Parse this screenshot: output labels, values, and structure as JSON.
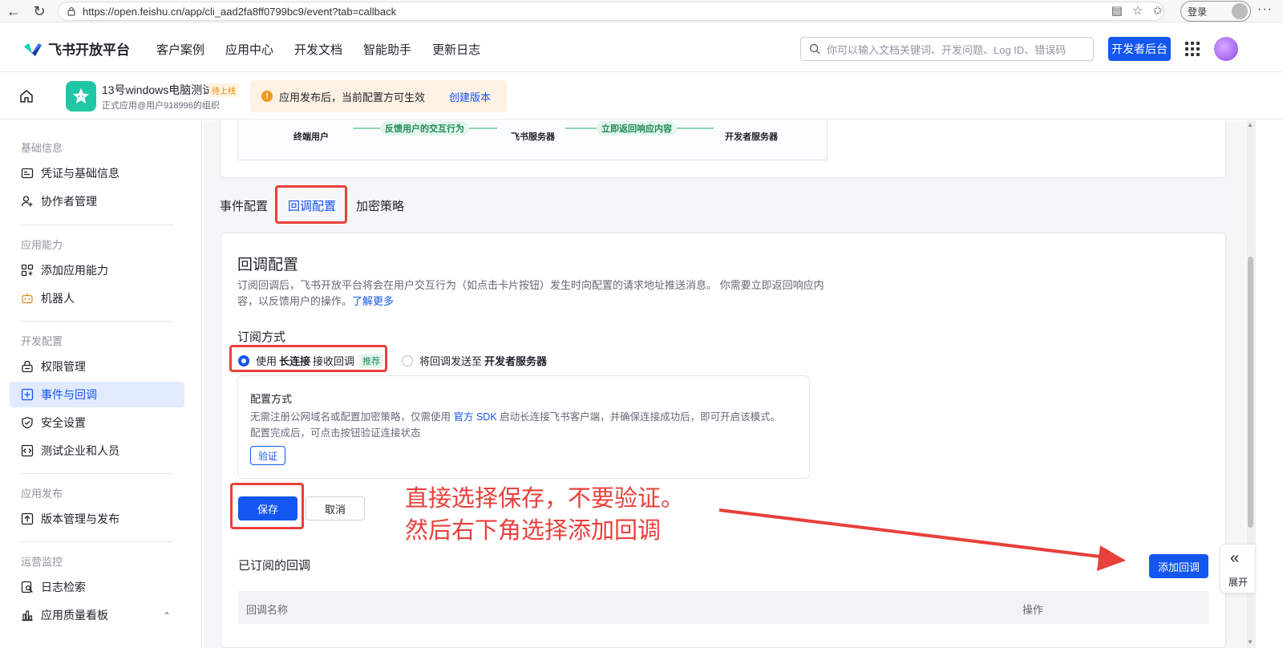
{
  "browser": {
    "url": "https://open.feishu.cn/app/cli_aad2fa8ff0799bc9/event?tab=callback",
    "login_label": "登录"
  },
  "topnav": {
    "logo_text": "飞书开放平台",
    "links": [
      "客户案例",
      "应用中心",
      "开发文档",
      "智能助手",
      "更新日志"
    ],
    "search_placeholder": "你可以输入文档关键词、开发问题、Log ID、错误码",
    "dev_button": "开发者后台"
  },
  "appbar": {
    "app_name": "13号windows电脑测试",
    "status_badge": "待上线",
    "app_sub": "正式应用@用户918996的组织",
    "notice_text": "应用发布后，当前配置方可生效",
    "notice_link": "创建版本"
  },
  "sidebar": {
    "sections": [
      {
        "title": "基础信息",
        "items": [
          {
            "label": "凭证与基础信息",
            "icon": "credential-icon"
          },
          {
            "label": "协作者管理",
            "icon": "user-add-icon"
          }
        ]
      },
      {
        "title": "应用能力",
        "items": [
          {
            "label": "添加应用能力",
            "icon": "grid-add-icon"
          },
          {
            "label": "机器人",
            "icon": "robot-icon"
          }
        ]
      },
      {
        "title": "开发配置",
        "items": [
          {
            "label": "权限管理",
            "icon": "lock-icon"
          },
          {
            "label": "事件与回调",
            "icon": "event-icon"
          },
          {
            "label": "安全设置",
            "icon": "shield-icon"
          },
          {
            "label": "测试企业和人员",
            "icon": "code-icon"
          }
        ]
      },
      {
        "title": "应用发布",
        "items": [
          {
            "label": "版本管理与发布",
            "icon": "upload-icon"
          }
        ]
      },
      {
        "title": "运营监控",
        "items": [
          {
            "label": "日志检索",
            "icon": "log-search-icon"
          },
          {
            "label": "应用质量看板",
            "icon": "bar-chart-icon"
          }
        ]
      }
    ],
    "active_item": "事件与回调"
  },
  "diagram": {
    "node_end_user": "终端用户",
    "node_feishu_server": "飞书服务器",
    "node_dev_server": "开发者服务器",
    "arrow_feedback": "反馈用户的交互行为",
    "arrow_return": "立即返回响应内容"
  },
  "tabs": [
    {
      "label": "事件配置",
      "active": false
    },
    {
      "label": "回调配置",
      "active": true
    },
    {
      "label": "加密策略",
      "active": false
    }
  ],
  "callback": {
    "title": "回调配置",
    "desc": "订阅回调后，飞书开放平台将会在用户交互行为（如点击卡片按钮）发生时向配置的请求地址推送消息。 你需要立即返回响应内容，以反馈用户的操作。",
    "desc_link": "了解更多",
    "sub_label": "订阅方式",
    "option1_prefix": "使用 ",
    "option1_bold": "长连接",
    "option1_suffix": " 接收回调",
    "option1_tag": "推荐",
    "option2_prefix": "将回调发送至 ",
    "option2_bold": "开发者服务器",
    "method_title": "配置方式",
    "method_text_1": "无需注册公网域名或配置加密策略，仅需使用 ",
    "method_link": "官方 SDK",
    "method_text_2": " 启动长连接飞书客户端，并确保连接成功后，即可开启该模式。",
    "method_text_3": "配置完成后，可点击按钮验证连接状态",
    "verify_label": "验证",
    "save_label": "保存",
    "cancel_label": "取消",
    "subscribed_title": "已订阅的回调",
    "add_label": "添加回调",
    "col_name": "回调名称",
    "col_action": "操作"
  },
  "annotation": {
    "line1": "直接选择保存，不要验证。",
    "line2": "然后右下角选择添加回调",
    "color": "#e8403b"
  },
  "expand_label": "展开",
  "colors": {
    "accent": "#1456f0",
    "highlight": "#e8403b",
    "success": "#1f8a5a"
  }
}
